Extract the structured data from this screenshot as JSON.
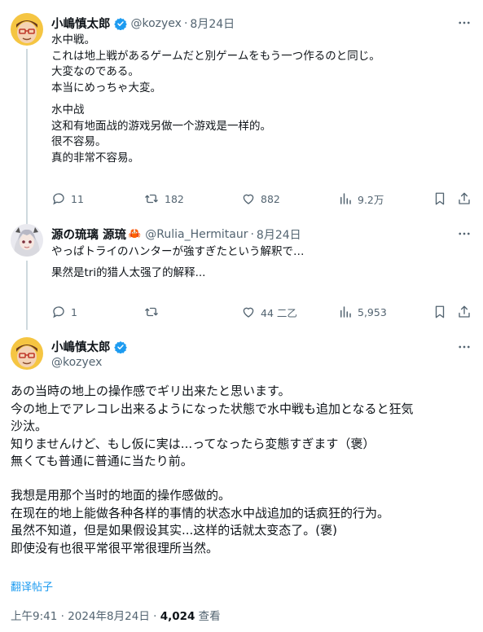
{
  "tweet1": {
    "name": "小嶋慎太郎",
    "handle": "@kozyex",
    "separator": "·",
    "date": "8月24日",
    "text_ja": "水中戦。\nこれは地上戦があるゲームだと別ゲームをもう一つ作るのと同じ。\n大変なのである。\n本当にめっちゃ大変。",
    "text_zh": "水中战\n这和有地面战的游戏另做一个游戏是一样的。\n很不容易。\n真的非常不容易。",
    "replies": "11",
    "retweets": "182",
    "likes": "882",
    "views": "9.2万"
  },
  "tweet2": {
    "name": "源の琉璃 源琉",
    "crab": "🦀",
    "handle": "@Rulia_Hermitaur",
    "separator": "·",
    "date": "8月24日",
    "text_ja": "やっぱトライのハンターが強すぎたという解釈で…",
    "text_zh": "果然是tri的猎人太强了的解释...",
    "replies": "1",
    "retweets": "",
    "likes": "44 二乙",
    "views": "5,953"
  },
  "tweet3": {
    "name": "小嶋慎太郎",
    "handle": "@kozyex",
    "text_ja": "あの当時の地上の操作感でギリ出来たと思います。\n今の地上でアレコレ出来るようになった状態で水中戦も追加となると狂気\n沙汰。\n知りませんけど、もし仮に実は...ってなったら変態すぎます（褒）\n無くても普通に普通に当たり前。",
    "text_zh": "我想是用那个当时的地面的操作感做的。\n在现在的地上能做各种各样的事情的状态水中战追加的话疯狂的行为。\n虽然不知道，但是如果假设其实...这样的话就太变态了。(褒)\n即使没有也很平常很平常很理所当然。",
    "translate_label": "翻译帖子",
    "time_date": "上午9:41 · 2024年8月24日 · ",
    "view_count": "4,024",
    "view_label": " 查看"
  },
  "colors": {
    "accent": "#1d9bf0",
    "text": "#0f1419",
    "secondary": "#536471",
    "thread_line": "#cfd9de"
  },
  "icons": [
    "verified-badge-icon",
    "more-icon",
    "reply-icon",
    "retweet-icon",
    "like-icon",
    "views-icon",
    "bookmark-icon",
    "share-icon"
  ]
}
